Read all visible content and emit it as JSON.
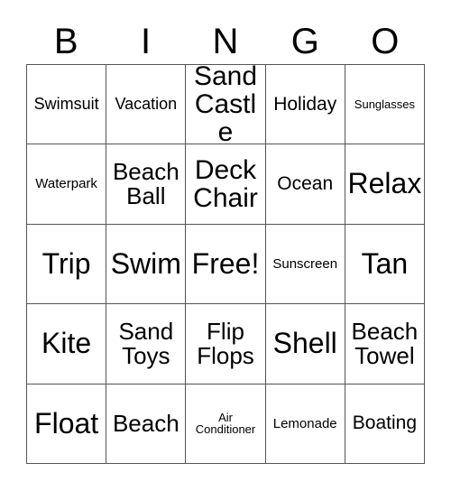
{
  "card": {
    "header_letters": [
      "B",
      "I",
      "N",
      "G",
      "O"
    ],
    "rows": [
      [
        {
          "label": "Swimsuit",
          "size": "s-sm"
        },
        {
          "label": "Vacation",
          "size": "s-sm"
        },
        {
          "label": "Sand Castle",
          "size": "s-xl"
        },
        {
          "label": "Holiday",
          "size": "s-md"
        },
        {
          "label": "Sunglasses",
          "size": "s-xxs"
        }
      ],
      [
        {
          "label": "Waterpark",
          "size": "s-xs"
        },
        {
          "label": "Beach Ball",
          "size": "s-lg"
        },
        {
          "label": "Deck Chair",
          "size": "s-xl"
        },
        {
          "label": "Ocean",
          "size": "s-md"
        },
        {
          "label": "Relax",
          "size": "s-xxl"
        }
      ],
      [
        {
          "label": "Trip",
          "size": "s-xxl"
        },
        {
          "label": "Swim",
          "size": "s-xxl"
        },
        {
          "label": "Free!",
          "size": "s-xxl"
        },
        {
          "label": "Sunscreen",
          "size": "s-xs"
        },
        {
          "label": "Tan",
          "size": "s-xxl"
        }
      ],
      [
        {
          "label": "Kite",
          "size": "s-xxl"
        },
        {
          "label": "Sand Toys",
          "size": "s-lg"
        },
        {
          "label": "Flip Flops",
          "size": "s-lg"
        },
        {
          "label": "Shell",
          "size": "s-xxl"
        },
        {
          "label": "Beach Towel",
          "size": "s-lg"
        }
      ],
      [
        {
          "label": "Float",
          "size": "s-xxl"
        },
        {
          "label": "Beach",
          "size": "s-lg"
        },
        {
          "label": "Air Conditioner",
          "size": "s-xxs"
        },
        {
          "label": "Lemonade",
          "size": "s-xs"
        },
        {
          "label": "Boating",
          "size": "s-md"
        }
      ]
    ]
  }
}
